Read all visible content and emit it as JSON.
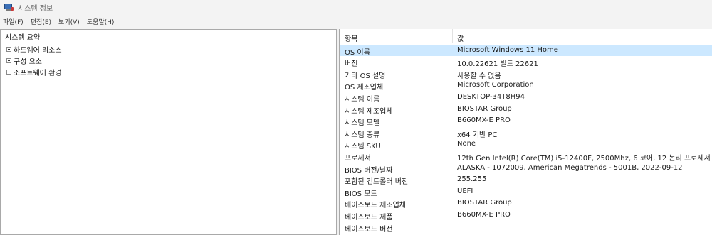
{
  "window": {
    "title": "시스템 정보"
  },
  "menu": [
    "파일(F)",
    "편집(E)",
    "보기(V)",
    "도움말(H)"
  ],
  "tree": {
    "root": "시스템 요약",
    "children": [
      "하드웨어 리소스",
      "구성 요소",
      "소프트웨어 환경"
    ]
  },
  "table": {
    "headers": {
      "item": "항목",
      "value": "값"
    },
    "rows": [
      {
        "item": "OS 이름",
        "value": "Microsoft Windows 11 Home"
      },
      {
        "item": "버전",
        "value": "10.0.22621 빌드 22621"
      },
      {
        "item": "기타 OS 설명",
        "value": "사용할 수 없음"
      },
      {
        "item": "OS 제조업체",
        "value": "Microsoft Corporation"
      },
      {
        "item": "시스템 이름",
        "value": "DESKTOP-34T8H94"
      },
      {
        "item": "시스템 제조업체",
        "value": "BIOSTAR Group"
      },
      {
        "item": "시스템 모델",
        "value": "B660MX-E PRO"
      },
      {
        "item": "시스템 종류",
        "value": "x64 기반 PC"
      },
      {
        "item": "시스템 SKU",
        "value": "None"
      },
      {
        "item": "프로세서",
        "value": "12th Gen Intel(R) Core(TM) i5-12400F, 2500Mhz, 6 코어, 12 논리 프로세서"
      },
      {
        "item": "BIOS 버전/날짜",
        "value": "ALASKA - 1072009, American Megatrends - 5001B, 2022-09-12"
      },
      {
        "item": "포함된 컨트롤러 버전",
        "value": "255.255"
      },
      {
        "item": "BIOS 모드",
        "value": "UEFI"
      },
      {
        "item": "베이스보드 제조업체",
        "value": "BIOSTAR Group"
      },
      {
        "item": "베이스보드 제품",
        "value": "B660MX-E PRO"
      },
      {
        "item": "베이스보드 버전",
        "value": ""
      }
    ]
  }
}
